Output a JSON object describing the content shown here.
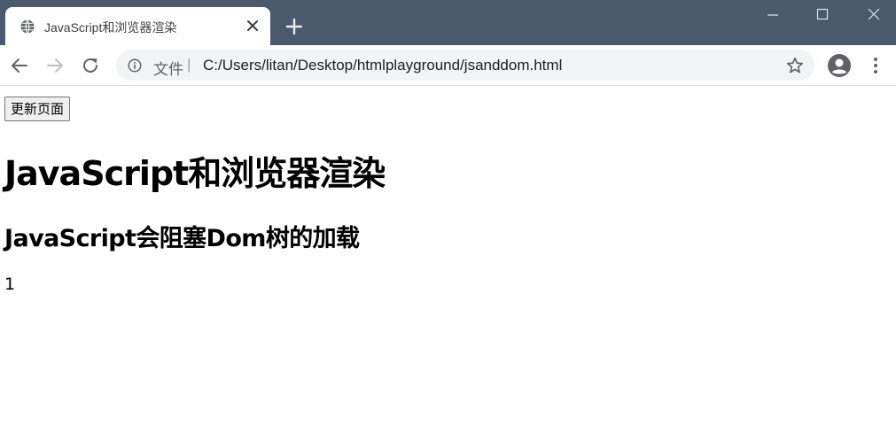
{
  "browser": {
    "tab": {
      "title": "JavaScript和浏览器渲染",
      "favicon": "globe-icon",
      "close": "close-icon"
    },
    "new_tab": "plus-icon",
    "window_controls": [
      "minimize-icon",
      "maximize-icon",
      "close-icon"
    ],
    "toolbar": {
      "back": "arrow-left-icon",
      "forward": "arrow-right-icon",
      "reload": "reload-icon",
      "omnibox": {
        "info_icon": "info-icon",
        "scheme_label": "文件",
        "separator": "|",
        "url": "C:/Users/litan/Desktop/htmlplayground/jsanddom.html",
        "bookmark_icon": "star-icon"
      },
      "profile": "account-icon",
      "menu": "more-vert-icon"
    },
    "colors": {
      "titlebar": "#4a596d",
      "omnibox_bg": "#f1f3f4"
    }
  },
  "page": {
    "button_label": "更新页面",
    "heading1": "JavaScript和浏览器渲染",
    "heading2": "JavaScript会阻塞Dom树的加载",
    "paragraph": "1"
  }
}
